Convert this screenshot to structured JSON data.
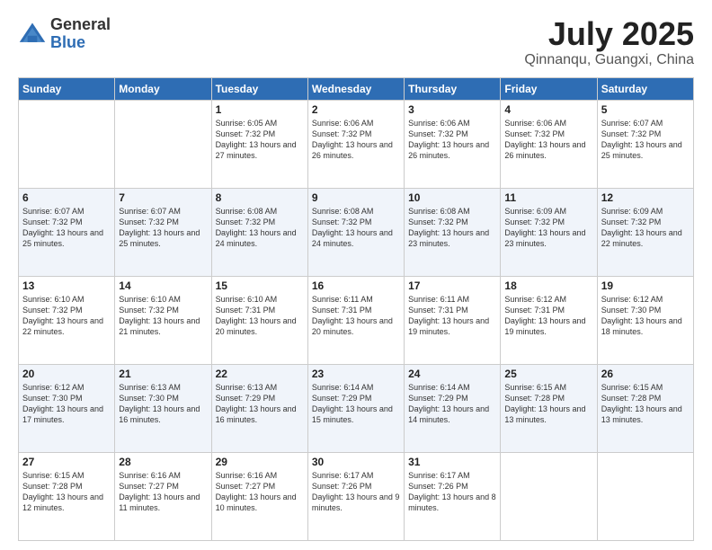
{
  "logo": {
    "general": "General",
    "blue": "Blue"
  },
  "title": {
    "month_year": "July 2025",
    "location": "Qinnanqu, Guangxi, China"
  },
  "days_of_week": [
    "Sunday",
    "Monday",
    "Tuesday",
    "Wednesday",
    "Thursday",
    "Friday",
    "Saturday"
  ],
  "weeks": [
    [
      {
        "day": "",
        "info": ""
      },
      {
        "day": "",
        "info": ""
      },
      {
        "day": "1",
        "info": "Sunrise: 6:05 AM\nSunset: 7:32 PM\nDaylight: 13 hours and 27 minutes."
      },
      {
        "day": "2",
        "info": "Sunrise: 6:06 AM\nSunset: 7:32 PM\nDaylight: 13 hours and 26 minutes."
      },
      {
        "day": "3",
        "info": "Sunrise: 6:06 AM\nSunset: 7:32 PM\nDaylight: 13 hours and 26 minutes."
      },
      {
        "day": "4",
        "info": "Sunrise: 6:06 AM\nSunset: 7:32 PM\nDaylight: 13 hours and 26 minutes."
      },
      {
        "day": "5",
        "info": "Sunrise: 6:07 AM\nSunset: 7:32 PM\nDaylight: 13 hours and 25 minutes."
      }
    ],
    [
      {
        "day": "6",
        "info": "Sunrise: 6:07 AM\nSunset: 7:32 PM\nDaylight: 13 hours and 25 minutes."
      },
      {
        "day": "7",
        "info": "Sunrise: 6:07 AM\nSunset: 7:32 PM\nDaylight: 13 hours and 25 minutes."
      },
      {
        "day": "8",
        "info": "Sunrise: 6:08 AM\nSunset: 7:32 PM\nDaylight: 13 hours and 24 minutes."
      },
      {
        "day": "9",
        "info": "Sunrise: 6:08 AM\nSunset: 7:32 PM\nDaylight: 13 hours and 24 minutes."
      },
      {
        "day": "10",
        "info": "Sunrise: 6:08 AM\nSunset: 7:32 PM\nDaylight: 13 hours and 23 minutes."
      },
      {
        "day": "11",
        "info": "Sunrise: 6:09 AM\nSunset: 7:32 PM\nDaylight: 13 hours and 23 minutes."
      },
      {
        "day": "12",
        "info": "Sunrise: 6:09 AM\nSunset: 7:32 PM\nDaylight: 13 hours and 22 minutes."
      }
    ],
    [
      {
        "day": "13",
        "info": "Sunrise: 6:10 AM\nSunset: 7:32 PM\nDaylight: 13 hours and 22 minutes."
      },
      {
        "day": "14",
        "info": "Sunrise: 6:10 AM\nSunset: 7:32 PM\nDaylight: 13 hours and 21 minutes."
      },
      {
        "day": "15",
        "info": "Sunrise: 6:10 AM\nSunset: 7:31 PM\nDaylight: 13 hours and 20 minutes."
      },
      {
        "day": "16",
        "info": "Sunrise: 6:11 AM\nSunset: 7:31 PM\nDaylight: 13 hours and 20 minutes."
      },
      {
        "day": "17",
        "info": "Sunrise: 6:11 AM\nSunset: 7:31 PM\nDaylight: 13 hours and 19 minutes."
      },
      {
        "day": "18",
        "info": "Sunrise: 6:12 AM\nSunset: 7:31 PM\nDaylight: 13 hours and 19 minutes."
      },
      {
        "day": "19",
        "info": "Sunrise: 6:12 AM\nSunset: 7:30 PM\nDaylight: 13 hours and 18 minutes."
      }
    ],
    [
      {
        "day": "20",
        "info": "Sunrise: 6:12 AM\nSunset: 7:30 PM\nDaylight: 13 hours and 17 minutes."
      },
      {
        "day": "21",
        "info": "Sunrise: 6:13 AM\nSunset: 7:30 PM\nDaylight: 13 hours and 16 minutes."
      },
      {
        "day": "22",
        "info": "Sunrise: 6:13 AM\nSunset: 7:29 PM\nDaylight: 13 hours and 16 minutes."
      },
      {
        "day": "23",
        "info": "Sunrise: 6:14 AM\nSunset: 7:29 PM\nDaylight: 13 hours and 15 minutes."
      },
      {
        "day": "24",
        "info": "Sunrise: 6:14 AM\nSunset: 7:29 PM\nDaylight: 13 hours and 14 minutes."
      },
      {
        "day": "25",
        "info": "Sunrise: 6:15 AM\nSunset: 7:28 PM\nDaylight: 13 hours and 13 minutes."
      },
      {
        "day": "26",
        "info": "Sunrise: 6:15 AM\nSunset: 7:28 PM\nDaylight: 13 hours and 13 minutes."
      }
    ],
    [
      {
        "day": "27",
        "info": "Sunrise: 6:15 AM\nSunset: 7:28 PM\nDaylight: 13 hours and 12 minutes."
      },
      {
        "day": "28",
        "info": "Sunrise: 6:16 AM\nSunset: 7:27 PM\nDaylight: 13 hours and 11 minutes."
      },
      {
        "day": "29",
        "info": "Sunrise: 6:16 AM\nSunset: 7:27 PM\nDaylight: 13 hours and 10 minutes."
      },
      {
        "day": "30",
        "info": "Sunrise: 6:17 AM\nSunset: 7:26 PM\nDaylight: 13 hours and 9 minutes."
      },
      {
        "day": "31",
        "info": "Sunrise: 6:17 AM\nSunset: 7:26 PM\nDaylight: 13 hours and 8 minutes."
      },
      {
        "day": "",
        "info": ""
      },
      {
        "day": "",
        "info": ""
      }
    ]
  ]
}
